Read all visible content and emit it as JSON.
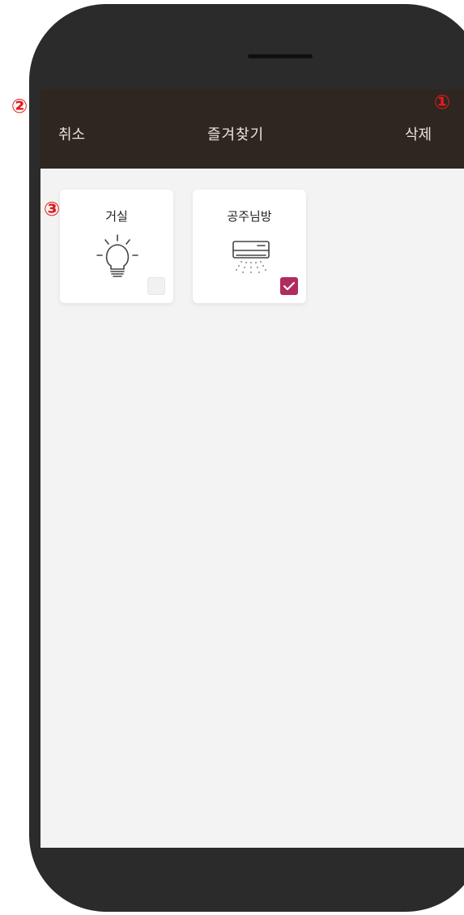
{
  "header": {
    "cancel_label": "취소",
    "title": "즐겨찾기",
    "delete_label": "삭제"
  },
  "favorites": [
    {
      "label": "거실",
      "icon": "light-bulb-icon",
      "checked": false
    },
    {
      "label": "공주님방",
      "icon": "air-conditioner-icon",
      "checked": true
    }
  ],
  "annotations": {
    "marker_1": "①",
    "marker_2": "②",
    "marker_3": "③"
  },
  "colors": {
    "header_bg": "#2f2621",
    "checked_accent": "#b02c5e",
    "annotation": "#e31b1b"
  }
}
